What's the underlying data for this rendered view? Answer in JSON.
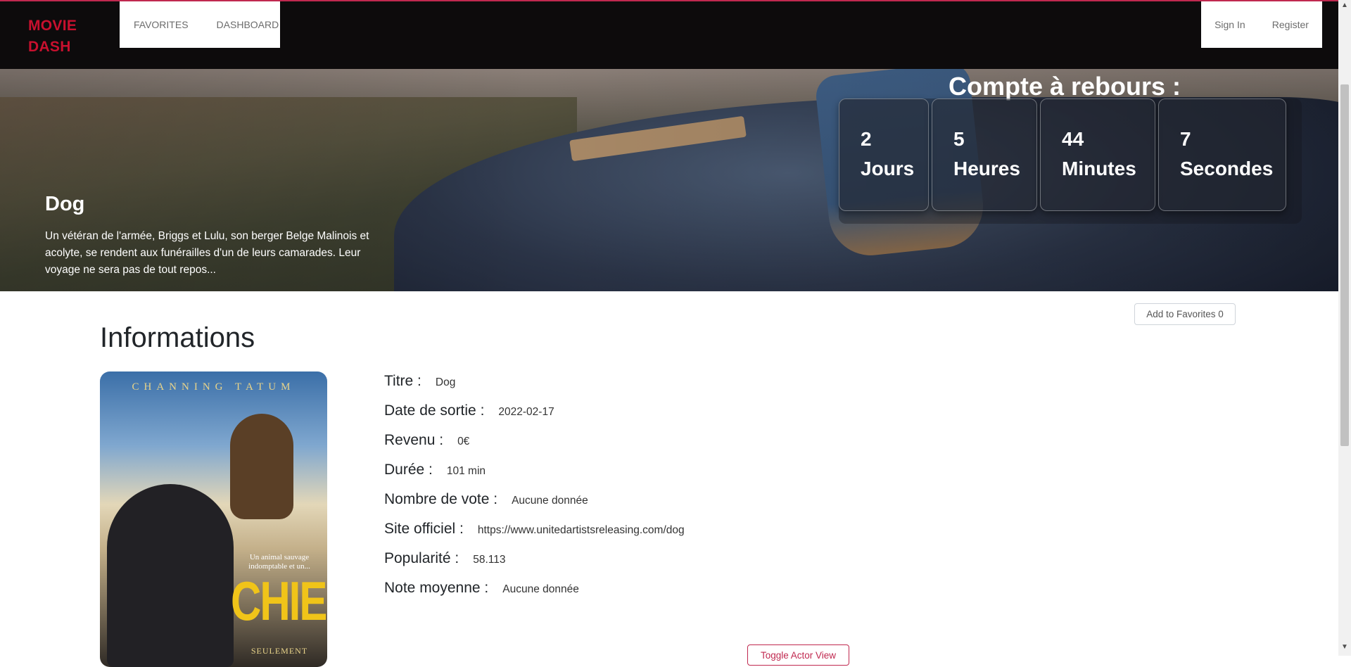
{
  "nav": {
    "brand_line1": "MOVIE",
    "brand_line2": "DASH",
    "links": [
      "FAVORITES",
      "DASHBOARD"
    ],
    "auth": [
      "Sign In",
      "Register"
    ],
    "accent_color": "#c8102e"
  },
  "hero": {
    "title": "Dog",
    "description": "Un vétéran de l'armée, Briggs et Lulu, son berger Belge Malinois et acolyte, se rendent aux funérailles d'un de leurs camarades. Leur voyage ne sera pas de tout repos..."
  },
  "countdown": {
    "title": "Compte à rebours :",
    "items": [
      {
        "value": "2",
        "unit": "Jours"
      },
      {
        "value": "5",
        "unit": "Heures"
      },
      {
        "value": "44",
        "unit": "Minutes"
      },
      {
        "value": "7",
        "unit": "Secondes"
      }
    ]
  },
  "actions": {
    "favorites": "Add to Favorites 0",
    "toggle": "Toggle Actor View"
  },
  "info": {
    "section_title": "Informations",
    "rows": [
      {
        "label": "Titre :",
        "value": "Dog"
      },
      {
        "label": "Date de sortie :",
        "value": "2022-02-17"
      },
      {
        "label": "Revenu :",
        "value": "0€"
      },
      {
        "label": "Durée :",
        "value": "101 min"
      },
      {
        "label": "Nombre de vote :",
        "value": "Aucune donnée"
      },
      {
        "label": "Site officiel :",
        "value": "https://www.unitedartistsreleasing.com/dog"
      },
      {
        "label": "Popularité :",
        "value": "58.113"
      },
      {
        "label": "Note moyenne :",
        "value": "Aucune donnée"
      }
    ]
  },
  "poster": {
    "top_text": "CHANNING TATUM",
    "tagline": "Un animal sauvage indomptable et un...",
    "title": "CHIEN",
    "bottom_text": "SEULEMENT"
  }
}
